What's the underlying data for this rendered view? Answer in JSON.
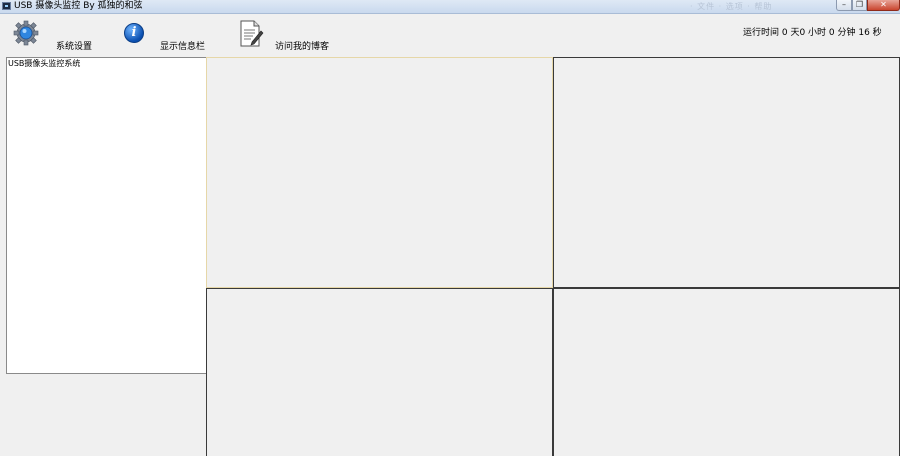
{
  "window": {
    "title": "USB 摄像头监控 By 孤独的和弦",
    "ghost_menu": "· 文件  · 选项  · 帮助",
    "min_glyph": "–",
    "max_glyph": "❐",
    "close_glyph": "✕"
  },
  "toolbar": {
    "items": [
      {
        "label": "系统设置",
        "icon": "gear-icon"
      },
      {
        "label": "显示信息栏",
        "icon": "info-icon"
      },
      {
        "label": "访问我的博客",
        "icon": "document-edit-icon"
      }
    ],
    "info_glyph": "i",
    "runtime": "运行时间 0 天0 小时 0 分钟 16 秒"
  },
  "tree": {
    "root_label": "USB摄像头监控系统"
  },
  "colors": {
    "active_pane_border": "#e6d7a8",
    "pane_border": "#3a3a3a",
    "background": "#f0f0f0"
  }
}
